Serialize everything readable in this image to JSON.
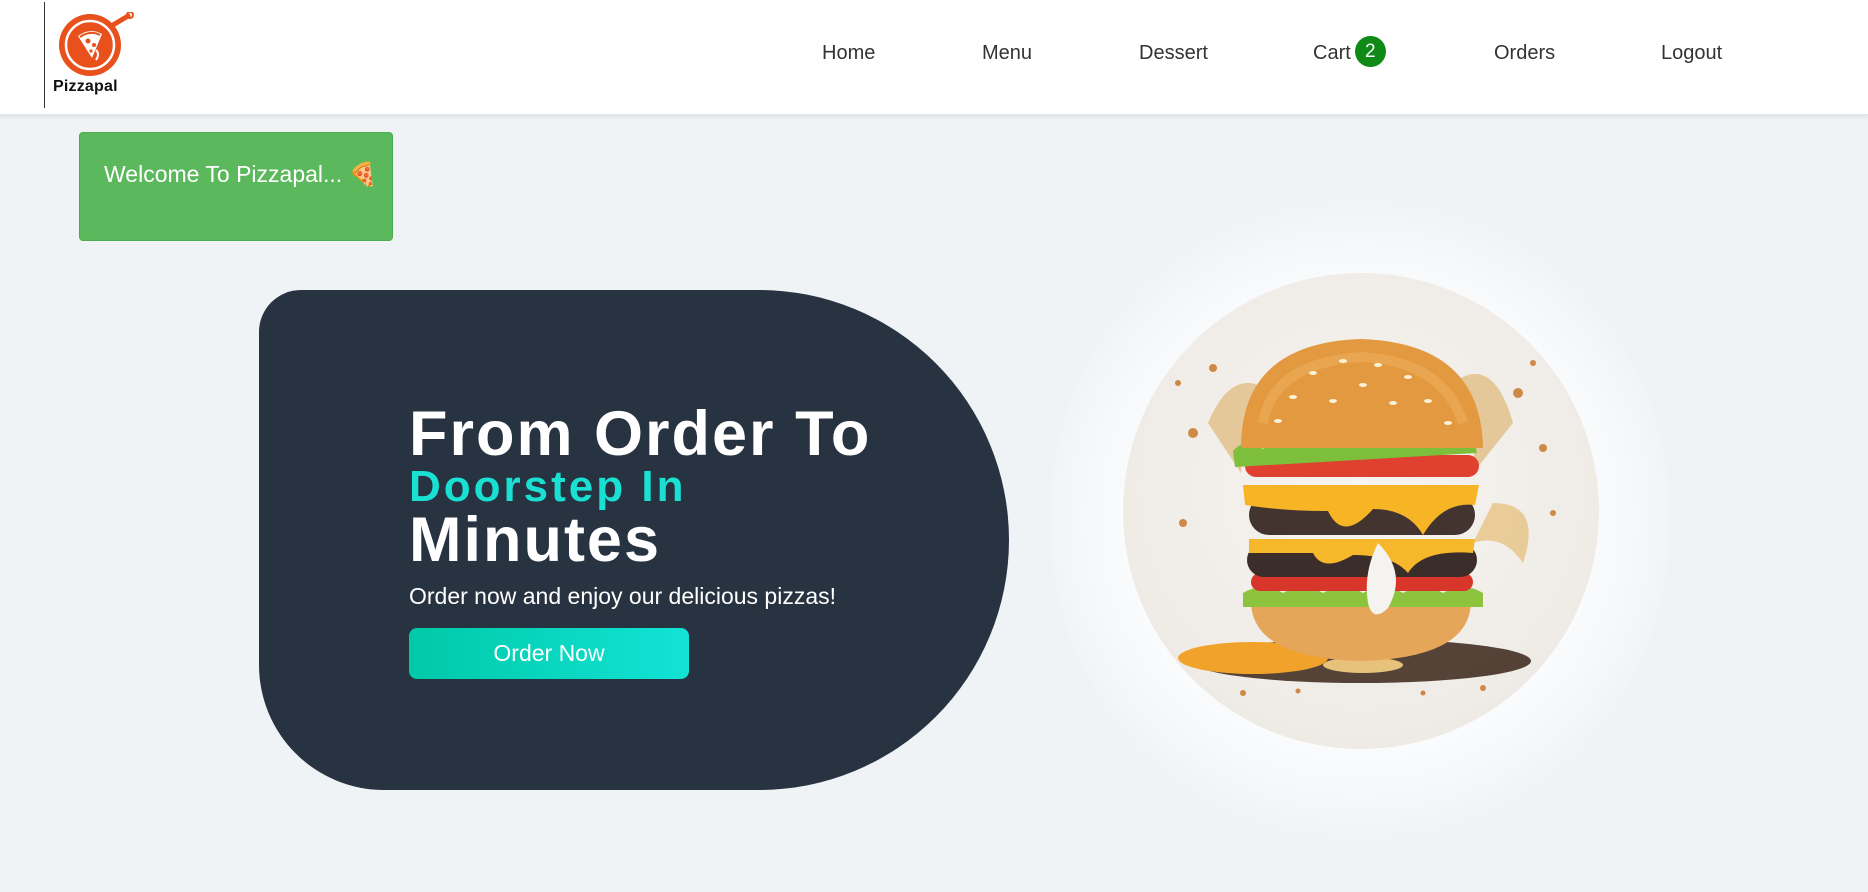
{
  "brand": {
    "name": "Pizzapal",
    "logo_icon": "pizza-pan-icon",
    "logo_color": "#e8511c"
  },
  "nav": {
    "items": [
      {
        "label": "Home"
      },
      {
        "label": "Menu"
      },
      {
        "label": "Dessert"
      },
      {
        "label": "Cart"
      },
      {
        "label": "Orders"
      },
      {
        "label": "Logout"
      }
    ],
    "cart_count": "2",
    "badge_color": "#0f8a17"
  },
  "welcome": {
    "message": "Welcome To Pizzapal... 🍕",
    "background": "#5cb85c"
  },
  "hero": {
    "line1": "From Order To",
    "line2": "Doorstep In",
    "line3": "Minutes",
    "subtitle": "Order now and enjoy our delicious pizzas!",
    "cta_label": "Order Now",
    "card_color": "#283341",
    "accent_color": "#19e0d2"
  },
  "hero_image": {
    "icon": "burger-splash-image"
  }
}
